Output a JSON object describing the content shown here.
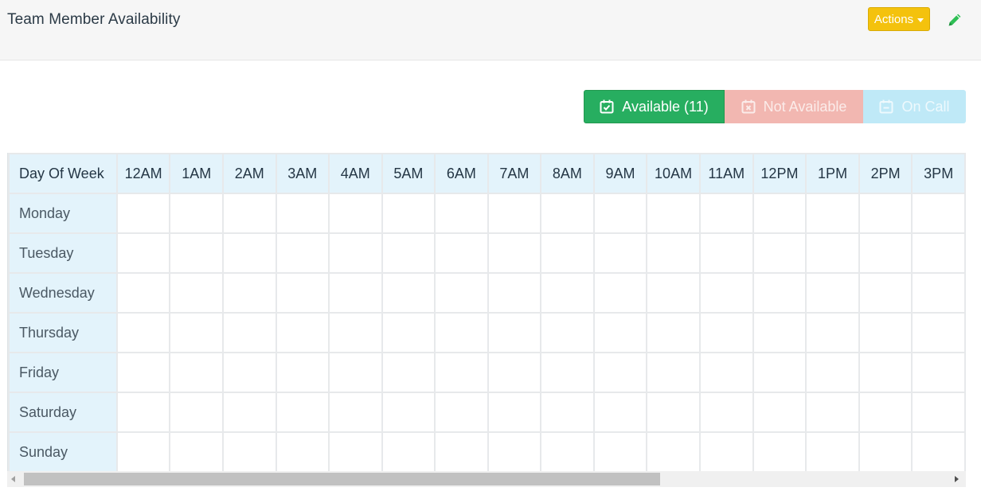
{
  "header": {
    "title": "Team Member Availability",
    "actions_label": "Actions",
    "edit_icon": "pencil-icon"
  },
  "legend": {
    "available_label": "Available (11)",
    "not_available_label": "Not Available",
    "on_call_label": "On Call",
    "colors": {
      "available": "#27ae60",
      "not_available": "#f2b7b1",
      "on_call": "#bfe9f7",
      "actions": "#f4c20d"
    }
  },
  "table": {
    "first_header": "Day Of Week",
    "hours": [
      "12AM",
      "1AM",
      "2AM",
      "3AM",
      "4AM",
      "5AM",
      "6AM",
      "7AM",
      "8AM",
      "9AM",
      "10AM",
      "11AM",
      "12PM",
      "1PM",
      "2PM",
      "3PM"
    ],
    "days": [
      "Monday",
      "Tuesday",
      "Wednesday",
      "Thursday",
      "Friday",
      "Saturday",
      "Sunday"
    ]
  }
}
